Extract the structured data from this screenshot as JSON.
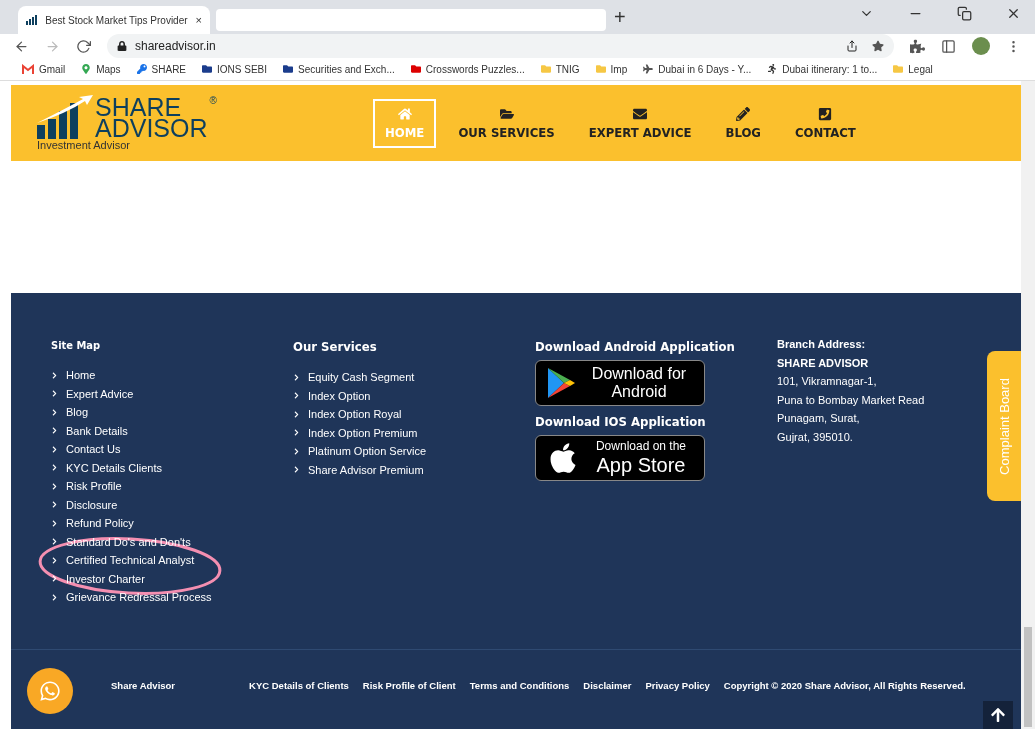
{
  "browser": {
    "tab": {
      "title": "Best Stock Market Tips Provider",
      "close": "×"
    },
    "new_tab": "+",
    "url": "shareadvisor.in",
    "bookmarks": [
      "Gmail",
      "Maps",
      "SHARE",
      "IONS SEBI",
      "Securities and Exch...",
      "Crosswords Puzzles...",
      "TNIG",
      "Imp",
      "Dubai in 6 Days - Y...",
      "Dubai itinerary: 1 to...",
      "Legal"
    ]
  },
  "header": {
    "logo": {
      "line1": "SHARE",
      "line2": "ADVISOR",
      "mark": "®",
      "tagline": "Investment Advisor"
    },
    "nav": [
      {
        "label": "HOME",
        "selected": true
      },
      {
        "label": "OUR SERVICES",
        "selected": false
      },
      {
        "label": "EXPERT ADVICE",
        "selected": false
      },
      {
        "label": "BLOG",
        "selected": false
      },
      {
        "label": "CONTACT",
        "selected": false
      }
    ]
  },
  "footer": {
    "site_map": {
      "title": "Site Map",
      "links": [
        "Home",
        "Expert Advice",
        "Blog",
        "Bank Details",
        "Contact Us",
        "KYC Details Clients",
        "Risk Profile",
        "Disclosure",
        "Refund Policy",
        "Standard Do's and Don'ts",
        "Certified Technical Analyst",
        "Investor Charter",
        "Grievance Redressal Process"
      ]
    },
    "services": {
      "title": "Our Services",
      "links": [
        "Equity Cash Segment",
        "Index Option",
        "Index Option Royal",
        "Index Option Premium",
        "Platinum Option Service",
        "Share Advisor Premium"
      ]
    },
    "apps": [
      {
        "title": "Download Android Application",
        "kind": "android",
        "line1": "Download for",
        "line2": "Android"
      },
      {
        "title": "Download IOS Application",
        "kind": "ios",
        "line1": "Download on the",
        "line2": "App Store"
      }
    ],
    "address": {
      "heading": "Branch Address:",
      "name": "SHARE ADVISOR",
      "lines": [
        "101, Vikramnagar-1,",
        "Puna to Bombay Market Read",
        "Punagam, Surat,",
        "Gujrat, 395010."
      ]
    },
    "complaint_tab": "Complaint Board",
    "bottom": {
      "brand": "Share Advisor",
      "links": [
        "KYC Details of Clients",
        "Risk Profile of Client",
        "Terms and Conditions",
        "Disclaimer",
        "Privacy Policy"
      ],
      "copyright": "Copyright © 2020 Share Advisor, All Rights Reserved."
    }
  }
}
